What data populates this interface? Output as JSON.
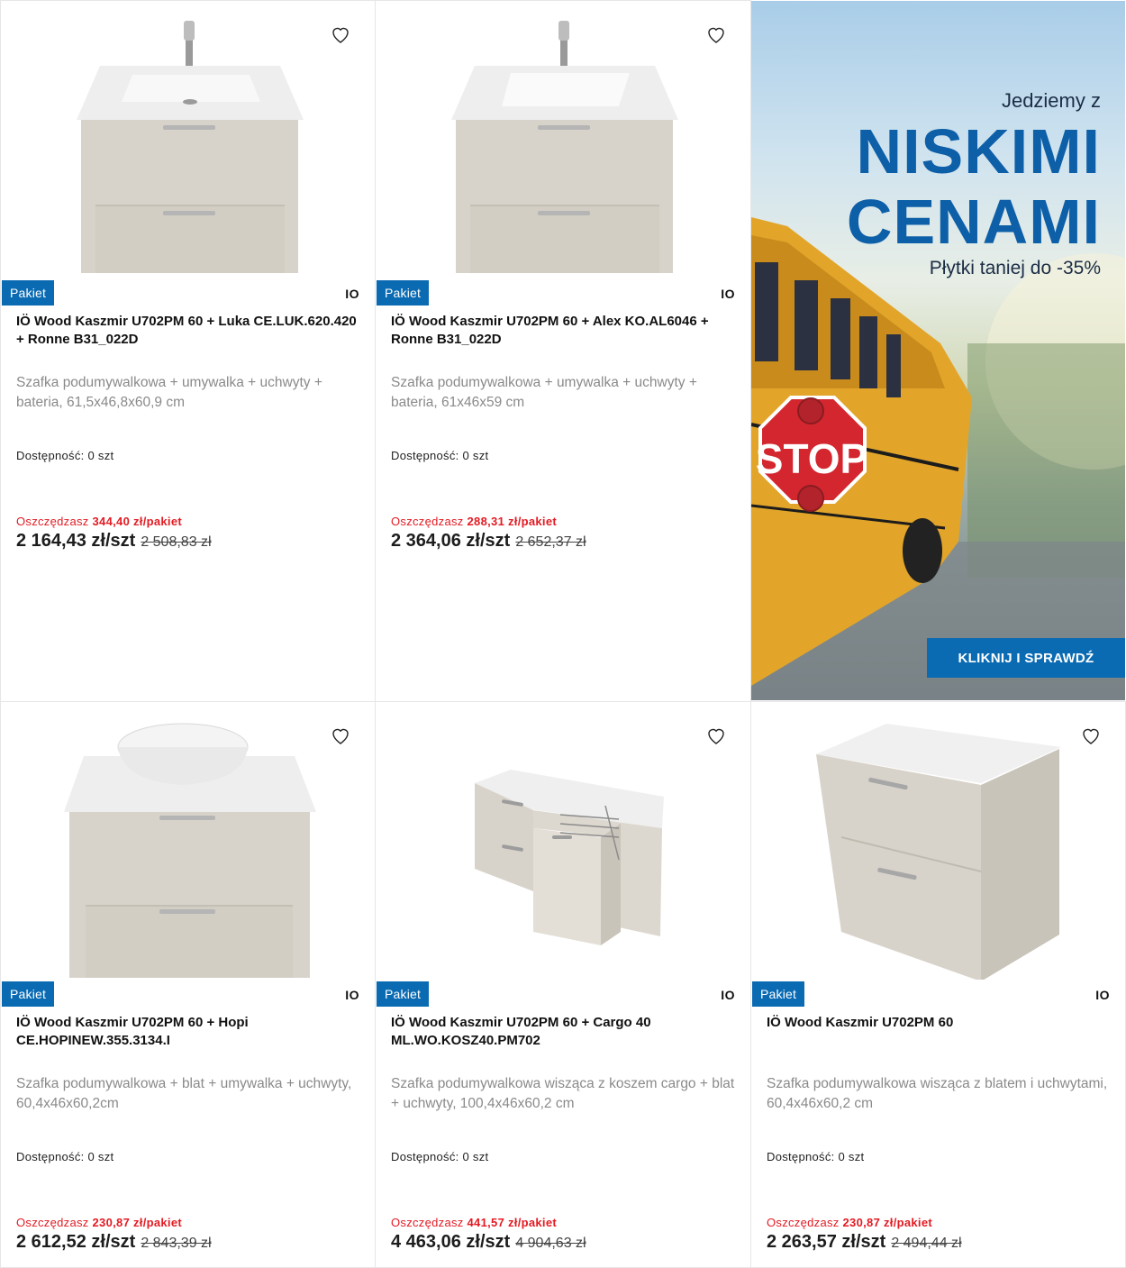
{
  "common": {
    "badge": "Pakiet",
    "brand": "IO",
    "avail_label": "Dostępność:",
    "save_label": "Oszczędzasz"
  },
  "banner": {
    "line1": "Jedziemy z",
    "line2": "NISKIMI",
    "line3": "CENAMI",
    "line4": "Płytki taniej do -35%",
    "sign": "STOP",
    "cta": "KLIKNIJ I SPRAWDŹ",
    "colors": {
      "accent": "#0a6bb3",
      "headline": "#0d5fa8"
    }
  },
  "products": [
    {
      "title": "IÖ Wood Kaszmir U702PM 60 + Luka CE.LUK.620.420 + Ronne B31_022D",
      "desc": "Szafka podumywalkowa + umywalka + uchwyty + bateria, 61,5x46,8x60,9 cm",
      "avail": "0 szt",
      "save": "344,40 zł/pakiet",
      "price": "2 164,43 zł/szt",
      "old_price": "2 508,83 zł",
      "image_icon": "vanity-with-basin-and-faucet"
    },
    {
      "title": "IÖ Wood Kaszmir U702PM 60 + Alex KO.AL6046 + Ronne B31_022D",
      "desc": "Szafka podumywalkowa + umywalka + uchwyty + bateria, 61x46x59 cm",
      "avail": "0 szt",
      "save": "288,31 zł/pakiet",
      "price": "2 364,06 zł/szt",
      "old_price": "2 652,37 zł",
      "image_icon": "vanity-with-basin-and-faucet"
    },
    {
      "title": "IÖ Wood Kaszmir U702PM 60 + Hopi CE.HOPINEW.355.3134.I",
      "desc": "Szafka podumywalkowa + blat + umywalka + uchwyty, 60,4x46x60,2cm",
      "avail": "0 szt",
      "save": "230,87 zł/pakiet",
      "price": "2 612,52 zł/szt",
      "old_price": "2 843,39 zł",
      "image_icon": "vanity-with-bowl-basin"
    },
    {
      "title": "IÖ Wood Kaszmir U702PM 60 + Cargo 40 ML.WO.KOSZ40.PM702",
      "desc": "Szafka podumywalkowa wisząca z koszem cargo + blat + uchwyty, 100,4x46x60,2 cm",
      "avail": "0 szt",
      "save": "441,57 zł/pakiet",
      "price": "4 463,06 zł/szt",
      "old_price": "4 904,63 zł",
      "image_icon": "vanity-with-cargo-basket"
    },
    {
      "title": "IÖ Wood Kaszmir U702PM 60",
      "desc": "Szafka podumywalkowa wisząca z blatem i uchwytami, 60,4x46x60,2 cm",
      "avail": "0 szt",
      "save": "230,87 zł/pakiet",
      "price": "2 263,57 zł/szt",
      "old_price": "2 494,44 zł",
      "image_icon": "vanity-with-top"
    }
  ]
}
